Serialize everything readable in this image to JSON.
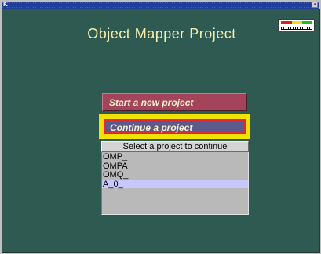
{
  "window": {
    "title_glyph": "K",
    "close_glyph": "▪"
  },
  "app": {
    "title": "Object Mapper Project"
  },
  "buttons": {
    "start_new": "Start a new project",
    "continue": "Continue a project"
  },
  "project_list": {
    "header": "Select a project to continue",
    "items": [
      "OMP_",
      "OMPA",
      "OMQ_",
      "A_0_"
    ],
    "selected_index": 3
  },
  "status_meter": {
    "colors": [
      "#d61e1e",
      "#f0dc1e",
      "#2ab42a"
    ]
  },
  "colors": {
    "background": "#2f5a52",
    "title_text": "#f2efb0",
    "start_button": "#a3445b",
    "continue_button": "#5c5a8a",
    "highlight_outline": "#f2e200",
    "selected_row": "#c8c8ff"
  }
}
